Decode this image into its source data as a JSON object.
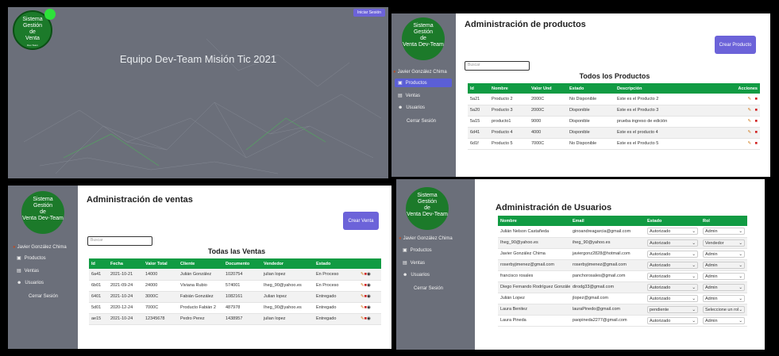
{
  "app": {
    "logo_lines": [
      "Sistema",
      "Gestión",
      "de",
      "Venta"
    ],
    "logo_sub": "Dev-Team",
    "user": "Javier González Chima",
    "logout": "Cerrar Sesión",
    "nav": [
      "Productos",
      "Ventas",
      "Usuarios"
    ]
  },
  "landing": {
    "login_label": "Iniciar Sesión",
    "heading": "Equipo Dev-Team Misión Tic 2021"
  },
  "products": {
    "title": "Administración de productos",
    "create_label": "Crear Producto",
    "search_placeholder": "Buscar",
    "subtitle": "Todos los Productos",
    "columns": [
      "Id",
      "Nombre",
      "Valor Und",
      "Estado",
      "Descripción",
      "Acciones"
    ],
    "rows": [
      [
        "5a21",
        "Producto 2",
        "2000C",
        "No Disponible",
        "Este es el Producto 2"
      ],
      [
        "5a20",
        "Producto 3",
        "2000C",
        "Disponible",
        "Este es el Producto 3"
      ],
      [
        "5a15",
        "producto1",
        "9000",
        "Disponible",
        "prueba ingreso de edición"
      ],
      [
        "6d41",
        "Producto 4",
        "4000",
        "Disponible",
        "Este es el producto 4"
      ],
      [
        "6d1f",
        "Producto 5",
        "7000C",
        "No Disponible",
        "Este es el Producto 5"
      ]
    ]
  },
  "sales": {
    "title": "Administración de ventas",
    "create_label": "Crear Venta",
    "search_placeholder": "Buscar",
    "subtitle": "Todas las Ventas",
    "columns": [
      "Id",
      "Fecha",
      "Valor Total",
      "Cliente",
      "Documento",
      "Vendedor",
      "Estado"
    ],
    "rows": [
      [
        "6a41",
        "2021-10-21",
        "14000",
        "Julián González",
        "1020754",
        "julian lopez",
        "En Proceso"
      ],
      [
        "6b01",
        "2021-09-24",
        "24000",
        "Viviana Rubio",
        "574001",
        "Iheg_90@yahoo.es",
        "En Proceso"
      ],
      [
        "6401",
        "2021-10-24",
        "3000C",
        "Fabián González",
        "1082161",
        "Julian lopez",
        "Entregado"
      ],
      [
        "5d01",
        "2020-12-24",
        "7000C",
        "Producto Fabián 2",
        "487978",
        "Iheg_90@yahoo.es",
        "Entregado"
      ],
      [
        "ae15",
        "2021-10-24",
        "12345678",
        "Pedro Perez",
        "1438957",
        "julian lopez",
        "Entregado"
      ]
    ]
  },
  "users": {
    "title": "Administración de Usuarios",
    "columns": [
      "Nombre",
      "Email",
      "Estado",
      "Rol"
    ],
    "rows": [
      [
        "Julián Nelson Castañeda",
        "ginoandreagarcia@gmail.com",
        "Autorizado",
        "Admin"
      ],
      [
        "Iheg_90@yahoo.es",
        "iheg_90@yahoo.es",
        "Autorizado",
        "Vendedor"
      ],
      [
        "Javier González Chima",
        "javiergonz2828@hotmail.com",
        "Autorizado",
        "Admin"
      ],
      [
        "roserbyjimenez@gmail.com",
        "roserbyjimenez@gmail.com",
        "Autorizado",
        "Admin"
      ],
      [
        "francisco rosales",
        "panchorosales@gmail.com",
        "Autorizado",
        "Admin"
      ],
      [
        "Diego Fernando Rodríguez González",
        "dirodg33@gmail.com",
        "Autorizado",
        "Admin"
      ],
      [
        "Julián Lopez",
        "jlopez@gmail.com",
        "Autorizado",
        "Admin"
      ],
      [
        "Laura Benitez",
        "lauraPinedo@gmail.com",
        "pendiente",
        "Seleccione un rol"
      ],
      [
        "Laura Pineda",
        "paopineda2277@gmail.com",
        "Autorizado",
        "Admin"
      ]
    ]
  },
  "colors": {
    "accent": "#6c63d9",
    "table_header": "#119b43",
    "sidebar": "#6b6f7a",
    "logo": "#1c7a2a"
  }
}
